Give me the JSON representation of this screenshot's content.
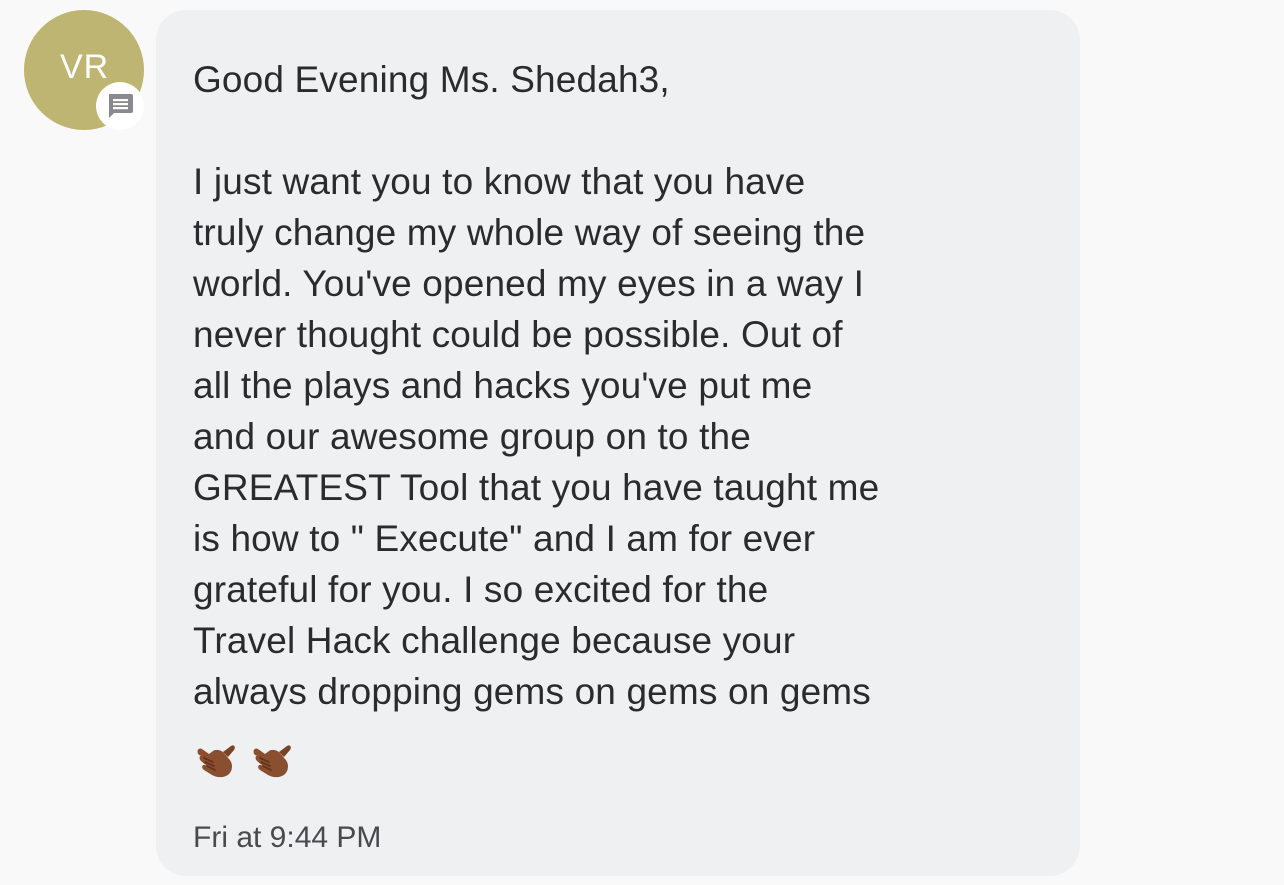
{
  "sender": {
    "initials": "VR",
    "avatar_color": "#bfb573",
    "badge_icon": "message-icon"
  },
  "message": {
    "greeting": "Good Evening Ms. Shedah3,",
    "body_lines": [
      "I just want you to know that you have",
      "truly change my whole way of seeing the",
      "world. You've opened my eyes in a way I",
      "never thought could be possible. Out of",
      "all the plays and hacks you've put me",
      "and our awesome group on to the",
      "GREATEST Tool that you have taught me",
      "is how to \" Execute\" and I am for ever",
      "grateful for you. I so excited for the",
      "Travel Hack challenge because your",
      "always dropping gems on gems on gems"
    ],
    "emoji": [
      "call-me-hand-emoji",
      "call-me-hand-emoji"
    ],
    "timestamp": "Fri at 9:44 PM"
  },
  "colors": {
    "bubble_bg": "#eff0f2",
    "page_bg": "#f9f9fa",
    "text": "#2b2b2d",
    "emoji_skin": "#8a4f2e"
  }
}
